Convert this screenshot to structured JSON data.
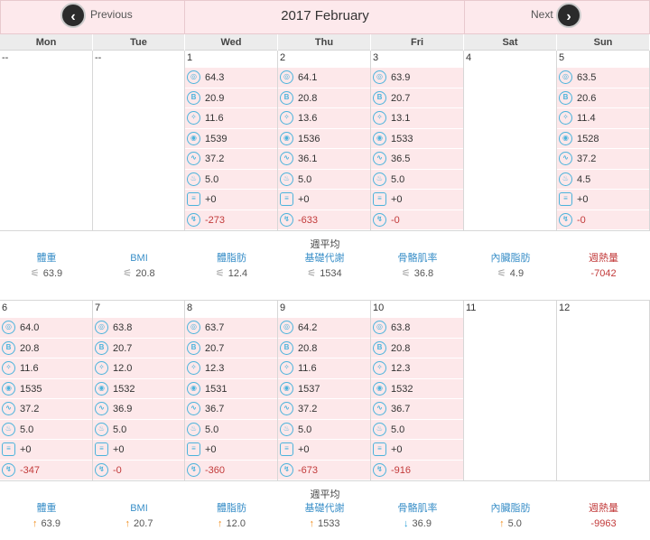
{
  "header": {
    "prev_label": "Previous",
    "next_label": "Next",
    "title": "2017 February"
  },
  "weekdays": [
    "Mon",
    "Tue",
    "Wed",
    "Thu",
    "Fri",
    "Sat",
    "Sun"
  ],
  "metric_icons": [
    "weight-icon",
    "bmi-icon",
    "body-fat-icon",
    "metabolism-icon",
    "muscle-icon",
    "visceral-fat-icon",
    "calorie-in-icon",
    "calorie-burn-icon"
  ],
  "weeks": [
    {
      "days": [
        {
          "num": "--",
          "values": null
        },
        {
          "num": "--",
          "values": null
        },
        {
          "num": "1",
          "values": [
            "64.3",
            "20.9",
            "11.6",
            "1539",
            "37.2",
            "5.0",
            "+0",
            "-273"
          ]
        },
        {
          "num": "2",
          "values": [
            "64.1",
            "20.8",
            "13.6",
            "1536",
            "36.1",
            "5.0",
            "+0",
            "-633"
          ]
        },
        {
          "num": "3",
          "values": [
            "63.9",
            "20.7",
            "13.1",
            "1533",
            "36.5",
            "5.0",
            "+0",
            "-0"
          ]
        },
        {
          "num": "4",
          "values": null
        },
        {
          "num": "5",
          "values": [
            "63.5",
            "20.6",
            "11.4",
            "1528",
            "37.2",
            "4.5",
            "+0",
            "-0"
          ]
        }
      ],
      "avg": {
        "title": "週平均",
        "labels": [
          "體重",
          "BMI",
          "體脂肪",
          "基礎代謝",
          "骨骼肌率",
          "內臟脂肪",
          "週熱量"
        ],
        "values": [
          "63.9",
          "20.8",
          "12.4",
          "1534",
          "36.8",
          "4.9",
          "-7042"
        ],
        "trends": [
          "flat",
          "flat",
          "flat",
          "flat",
          "flat",
          "flat",
          "none"
        ]
      }
    },
    {
      "days": [
        {
          "num": "6",
          "values": [
            "64.0",
            "20.8",
            "11.6",
            "1535",
            "37.2",
            "5.0",
            "+0",
            "-347"
          ]
        },
        {
          "num": "7",
          "values": [
            "63.8",
            "20.7",
            "12.0",
            "1532",
            "36.9",
            "5.0",
            "+0",
            "-0"
          ]
        },
        {
          "num": "8",
          "values": [
            "63.7",
            "20.7",
            "12.3",
            "1531",
            "36.7",
            "5.0",
            "+0",
            "-360"
          ]
        },
        {
          "num": "9",
          "values": [
            "64.2",
            "20.8",
            "11.6",
            "1537",
            "37.2",
            "5.0",
            "+0",
            "-673"
          ]
        },
        {
          "num": "10",
          "values": [
            "63.8",
            "20.8",
            "12.3",
            "1532",
            "36.7",
            "5.0",
            "+0",
            "-916"
          ]
        },
        {
          "num": "11",
          "values": null
        },
        {
          "num": "12",
          "values": null
        }
      ],
      "avg": {
        "title": "週平均",
        "labels": [
          "體重",
          "BMI",
          "體脂肪",
          "基礎代謝",
          "骨骼肌率",
          "內臟脂肪",
          "週熱量"
        ],
        "values": [
          "63.9",
          "20.7",
          "12.0",
          "1533",
          "36.9",
          "5.0",
          "-9963"
        ],
        "trends": [
          "up",
          "up",
          "up",
          "up",
          "down",
          "up",
          "none"
        ]
      }
    }
  ]
}
